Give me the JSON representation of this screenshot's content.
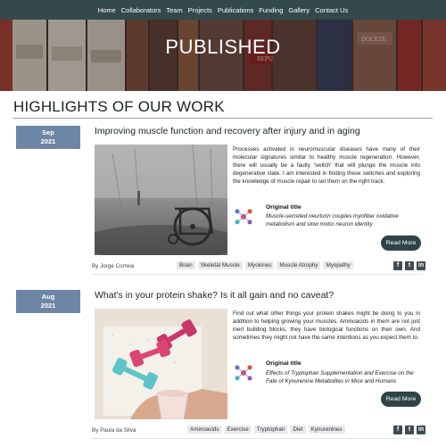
{
  "nav": {
    "items": [
      "Home",
      "Collaborators",
      "Team",
      "Projects",
      "Publications",
      "Funding",
      "Gallery",
      "Contact Us"
    ]
  },
  "hero": {
    "title": "PUBLISHED",
    "book_texts": [
      "DOCETE",
      "REPUBLICA"
    ]
  },
  "section": {
    "title": "HIGHLIGHTS OF OUR WORK"
  },
  "posts": [
    {
      "date_month": "Sep",
      "date_year": "2021",
      "title": "Improving muscle function and recovery after injury and in aging",
      "text": "Processes activated in neuromuscular diseases have many of their molecular signatures similar to healthy muscle regeneration. However, there will usually be a faulty 'switch' that will plunge the muscle into degenerative state. I am interested in finding these switches and exploring the knowledge of muscle repair to set them on the right track.",
      "original_label": "Original title",
      "original_title": "Muscle-secreted neurturin couples myofiber oxidative metabolism and slow motor neuron identity",
      "read_more": "Read More",
      "author": "By Jorge Correia",
      "tags": [
        "Brain",
        "Skeletal Muscle",
        "Myokines",
        "Muscle Atrophy",
        "Myopathy"
      ]
    },
    {
      "date_month": "Aug",
      "date_year": "2021",
      "title": "What's in your protein shake? Is it all gain and no caveat?",
      "text": "Find out what other things your protein shakes might be doing to you in addition to helping growing your muscles. Aminoacids in them are not just inert building blocks, they have biological functions on their own. And sometimes they might not have the same intentions as you expect them to.",
      "original_label": "Original title",
      "original_title": "Effects of Tryptophan Supplementation and Exercise on the Fate of Kynurenine Metabolites in Mice and Humans",
      "read_more": "Read More",
      "author": "By Paula da Silva",
      "tags": [
        "Aminoacids",
        "Exercise",
        "Tryptophan",
        "Diet",
        "Kynurenines"
      ]
    }
  ],
  "share_icons": [
    "facebook-icon",
    "twitter-icon",
    "linkedin-icon"
  ],
  "colors": {
    "nav_bg": "#33494c",
    "date_badge": "#6d86a6",
    "button_bg": "#2f4447"
  }
}
